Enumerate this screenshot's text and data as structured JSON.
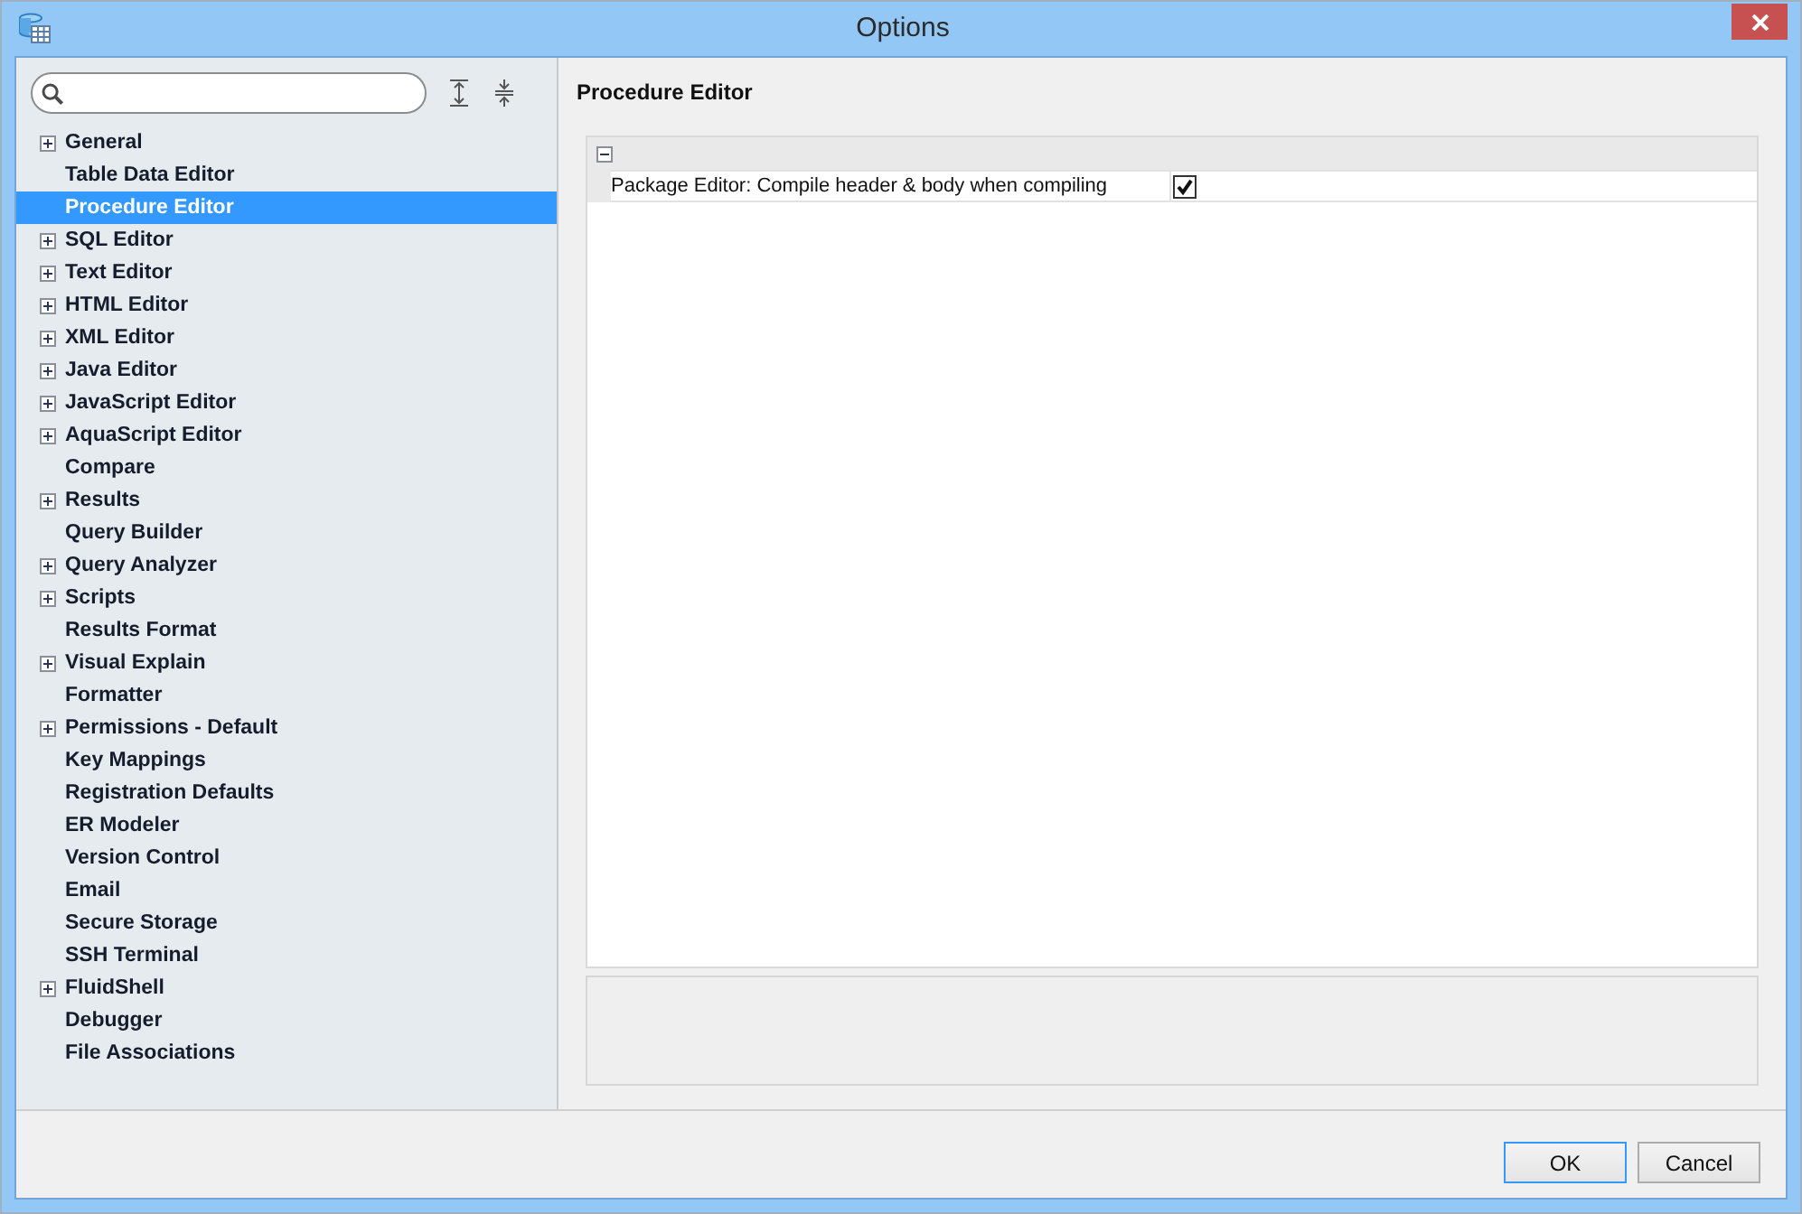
{
  "window": {
    "title": "Options"
  },
  "sidebar": {
    "items": [
      {
        "label": "General",
        "kind": "group",
        "expanded": false,
        "selected": false
      },
      {
        "label": "Table Data Editor",
        "kind": "leaf",
        "selected": false
      },
      {
        "label": "Procedure Editor",
        "kind": "leaf",
        "selected": true
      },
      {
        "label": "SQL Editor",
        "kind": "group",
        "expanded": false,
        "selected": false
      },
      {
        "label": "Text Editor",
        "kind": "group",
        "expanded": false,
        "selected": false
      },
      {
        "label": "HTML Editor",
        "kind": "group",
        "expanded": false,
        "selected": false
      },
      {
        "label": "XML Editor",
        "kind": "group",
        "expanded": false,
        "selected": false
      },
      {
        "label": "Java Editor",
        "kind": "group",
        "expanded": false,
        "selected": false
      },
      {
        "label": "JavaScript Editor",
        "kind": "group",
        "expanded": false,
        "selected": false
      },
      {
        "label": "AquaScript Editor",
        "kind": "group",
        "expanded": false,
        "selected": false
      },
      {
        "label": "Compare",
        "kind": "leaf",
        "selected": false
      },
      {
        "label": "Results",
        "kind": "group",
        "expanded": false,
        "selected": false
      },
      {
        "label": "Query Builder",
        "kind": "leaf",
        "selected": false
      },
      {
        "label": "Query Analyzer",
        "kind": "group",
        "expanded": false,
        "selected": false
      },
      {
        "label": "Scripts",
        "kind": "group",
        "expanded": false,
        "selected": false
      },
      {
        "label": "Results Format",
        "kind": "leaf",
        "selected": false
      },
      {
        "label": "Visual Explain",
        "kind": "group",
        "expanded": false,
        "selected": false
      },
      {
        "label": "Formatter",
        "kind": "leaf",
        "selected": false
      },
      {
        "label": "Permissions - Default",
        "kind": "group",
        "expanded": false,
        "selected": false
      },
      {
        "label": "Key Mappings",
        "kind": "leaf",
        "selected": false
      },
      {
        "label": "Registration Defaults",
        "kind": "leaf",
        "selected": false
      },
      {
        "label": "ER Modeler",
        "kind": "leaf",
        "selected": false
      },
      {
        "label": "Version Control",
        "kind": "leaf",
        "selected": false
      },
      {
        "label": "Email",
        "kind": "leaf",
        "selected": false
      },
      {
        "label": "Secure Storage",
        "kind": "leaf",
        "selected": false
      },
      {
        "label": "SSH Terminal",
        "kind": "leaf",
        "selected": false
      },
      {
        "label": "FluidShell",
        "kind": "group",
        "expanded": false,
        "selected": false
      },
      {
        "label": "Debugger",
        "kind": "leaf",
        "selected": false
      },
      {
        "label": "File Associations",
        "kind": "leaf",
        "selected": false
      }
    ]
  },
  "page_title": "Procedure Editor",
  "property_grid": {
    "categories": [
      {
        "expanded": true,
        "properties": [
          {
            "label": "Package Editor: Compile header & body when compiling",
            "checked": true
          }
        ]
      }
    ]
  },
  "buttons": [
    {
      "label": "OK",
      "default": true
    },
    {
      "label": "Cancel",
      "default": false
    }
  ]
}
